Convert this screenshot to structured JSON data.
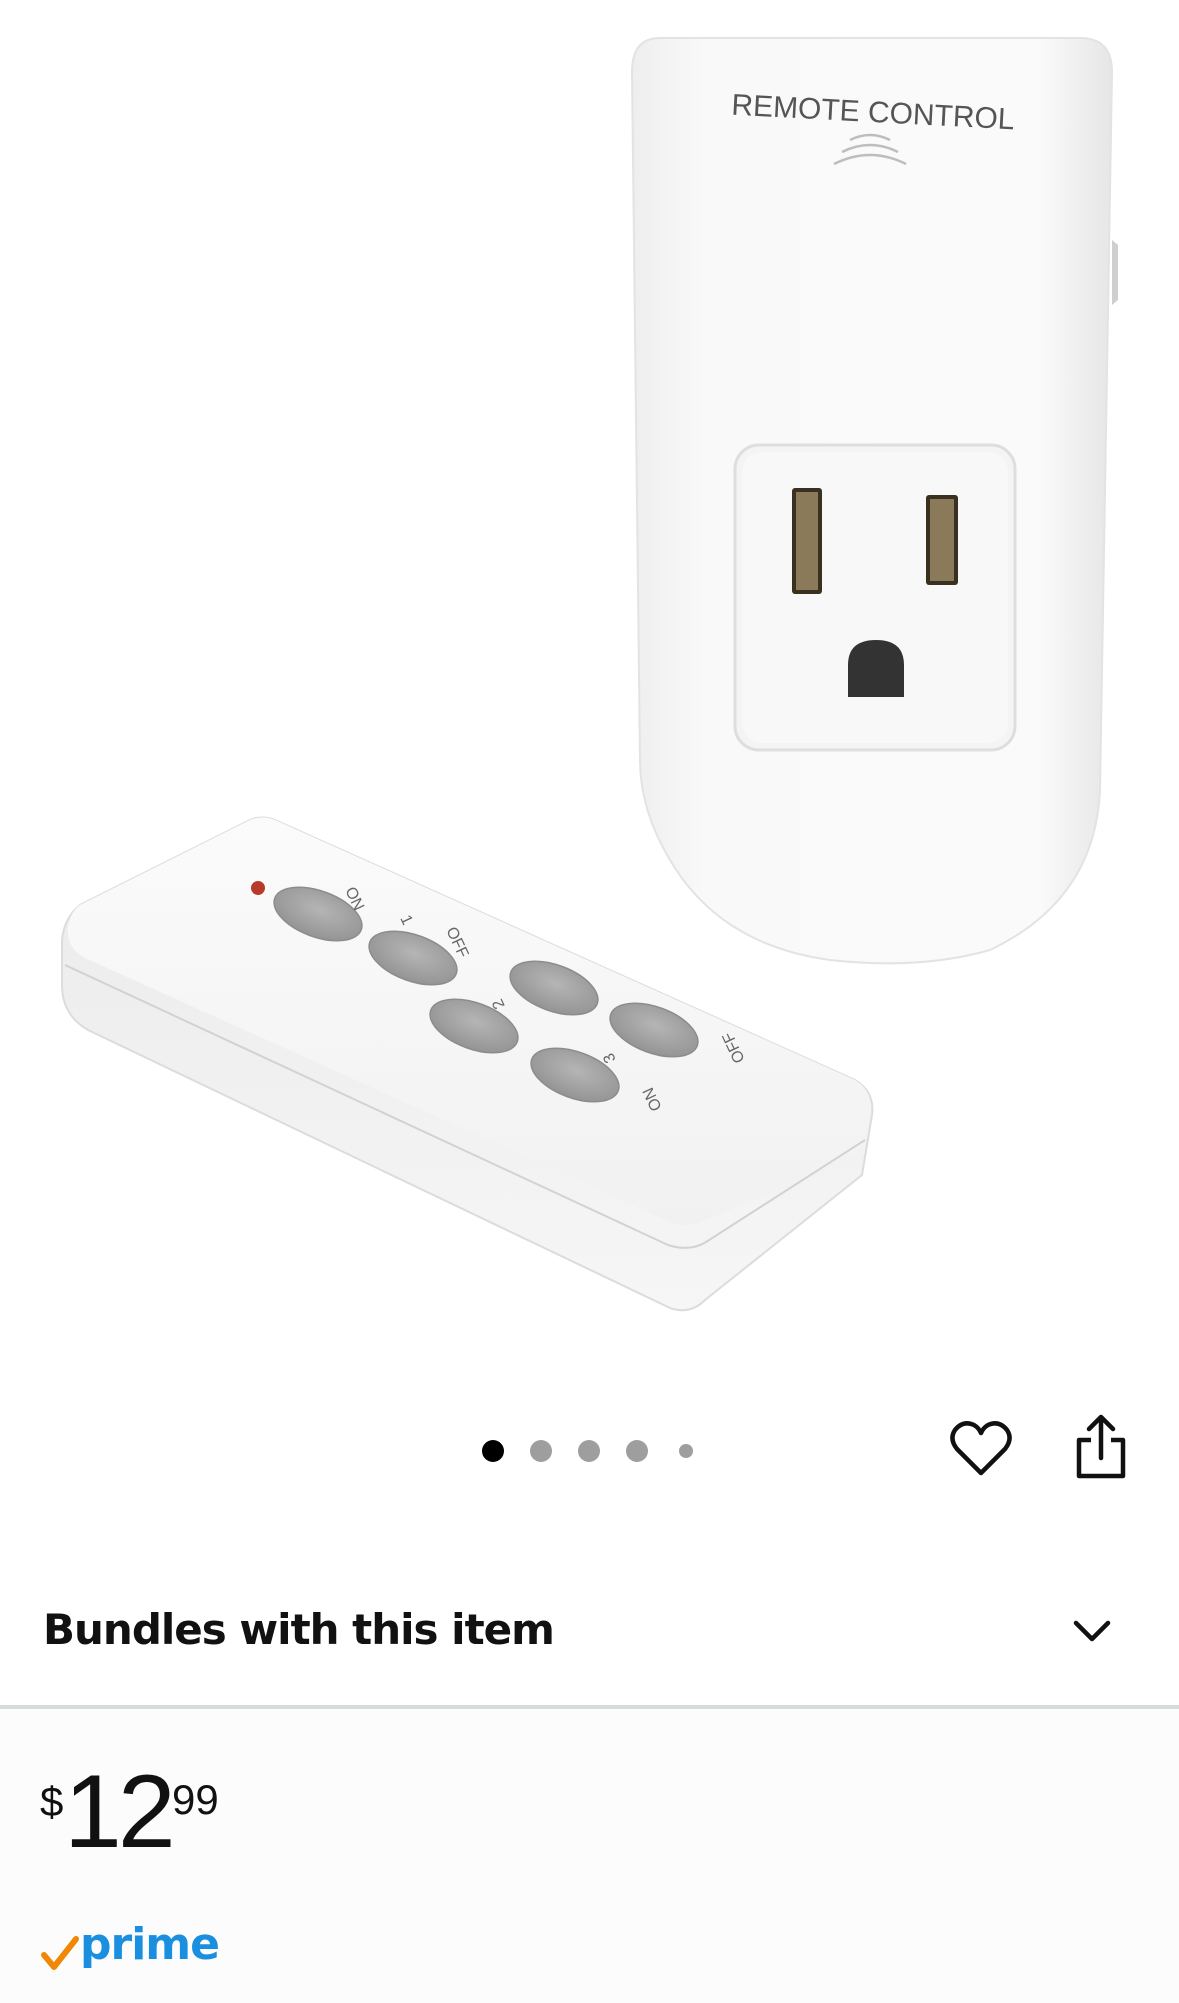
{
  "product": {
    "image_alt": "Remote control outlet with wireless remote",
    "device_label": "REMOTE CONTROL",
    "remote_labels": {
      "on_top": "ON",
      "one": "1",
      "off_top": "OFF",
      "two": "2",
      "three": "3",
      "off_bottom": "OFF",
      "on_bottom": "ON"
    }
  },
  "carousel": {
    "total": 5,
    "active_index": 0
  },
  "actions": {
    "favorite_icon": "heart-icon",
    "share_icon": "share-icon"
  },
  "bundles": {
    "title": "Bundles with this item",
    "icon": "chevron-down-icon"
  },
  "price": {
    "symbol": "$",
    "whole": "12",
    "fraction": "99"
  },
  "prime": {
    "label": "prime"
  },
  "colors": {
    "prime_blue": "#1a8fe0",
    "prime_check": "#f08804",
    "divider": "#d6dcdc"
  }
}
